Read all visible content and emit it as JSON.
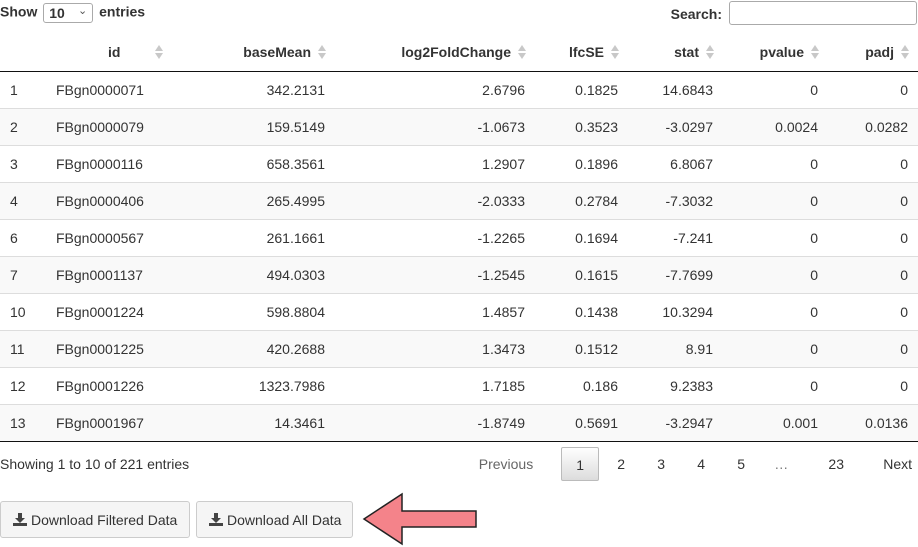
{
  "length_menu": {
    "show_label": "Show",
    "value": "10",
    "entries_label": "entries"
  },
  "search": {
    "label": "Search:",
    "value": ""
  },
  "table": {
    "columns": [
      "",
      "id",
      "baseMean",
      "log2FoldChange",
      "lfcSE",
      "stat",
      "pvalue",
      "padj"
    ],
    "rows": [
      [
        "1",
        "FBgn0000071",
        "342.2131",
        "2.6796",
        "0.1825",
        "14.6843",
        "0",
        "0"
      ],
      [
        "2",
        "FBgn0000079",
        "159.5149",
        "-1.0673",
        "0.3523",
        "-3.0297",
        "0.0024",
        "0.0282"
      ],
      [
        "3",
        "FBgn0000116",
        "658.3561",
        "1.2907",
        "0.1896",
        "6.8067",
        "0",
        "0"
      ],
      [
        "4",
        "FBgn0000406",
        "265.4995",
        "-2.0333",
        "0.2784",
        "-7.3032",
        "0",
        "0"
      ],
      [
        "6",
        "FBgn0000567",
        "261.1661",
        "-1.2265",
        "0.1694",
        "-7.241",
        "0",
        "0"
      ],
      [
        "7",
        "FBgn0001137",
        "494.0303",
        "-1.2545",
        "0.1615",
        "-7.7699",
        "0",
        "0"
      ],
      [
        "10",
        "FBgn0001224",
        "598.8804",
        "1.4857",
        "0.1438",
        "10.3294",
        "0",
        "0"
      ],
      [
        "11",
        "FBgn0001225",
        "420.2688",
        "1.3473",
        "0.1512",
        "8.91",
        "0",
        "0"
      ],
      [
        "12",
        "FBgn0001226",
        "1323.7986",
        "1.7185",
        "0.186",
        "9.2383",
        "0",
        "0"
      ],
      [
        "13",
        "FBgn0001967",
        "14.3461",
        "-1.8749",
        "0.5691",
        "-3.2947",
        "0.001",
        "0.0136"
      ]
    ]
  },
  "info": "Showing 1 to 10 of 221 entries",
  "pagination": {
    "previous": "Previous",
    "current": "1",
    "pages": [
      "2",
      "3",
      "4",
      "5"
    ],
    "ellipsis": "…",
    "last": "23",
    "next": "Next"
  },
  "buttons": {
    "download_filtered": "Download Filtered Data",
    "download_all": "Download All Data",
    "icon": "download-icon"
  },
  "annotation": {
    "arrow_color": "#f4838a",
    "arrow_stroke": "#222222"
  }
}
